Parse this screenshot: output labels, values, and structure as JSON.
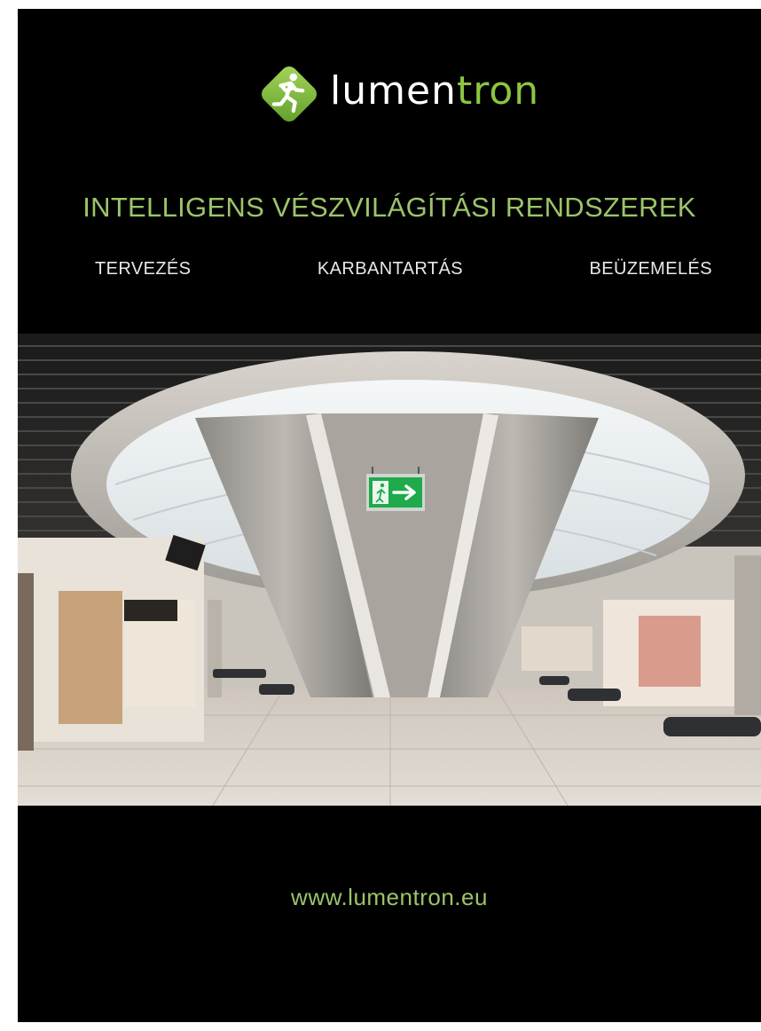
{
  "brand": {
    "name_prefix": "lumen",
    "name_suffix": "tron",
    "logo_icon": "running-man-exit-icon",
    "accent_color": "#8dc63f"
  },
  "headline": "INTELLIGENS VÉSZVILÁGÍTÁSI RENDSZEREK",
  "services": [
    "TERVEZÉS",
    "KARBANTARTÁS",
    "BEÜZEMELÉS"
  ],
  "photo": {
    "subject": "airport-terminal-hall-with-exit-sign",
    "exit_sign_icon": "running-man-arrow-right-icon",
    "exit_sign_color": "#1faa4b"
  },
  "website": "www.lumentron.eu"
}
